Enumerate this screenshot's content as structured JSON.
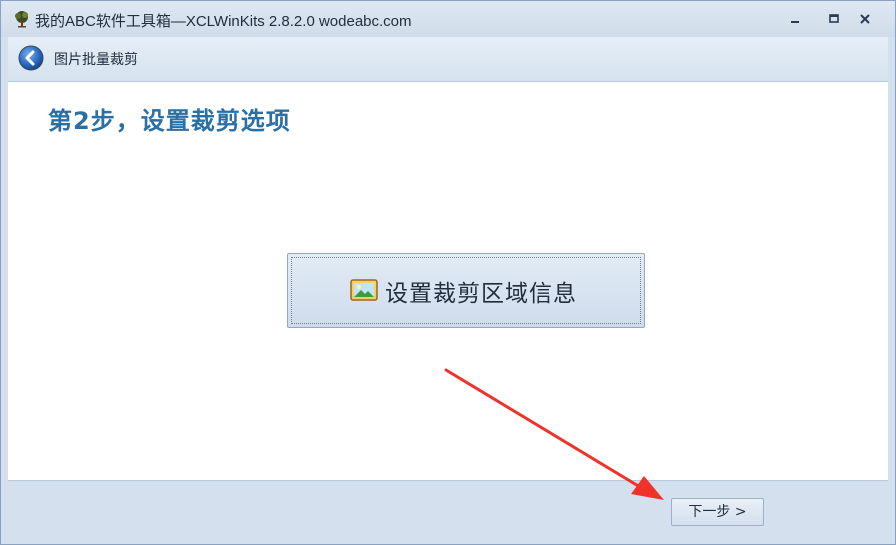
{
  "window": {
    "title": "我的ABC软件工具箱—XCLWinKits 2.8.2.0  wodeabc.com",
    "app_icon": "tree-logo-icon"
  },
  "nav": {
    "back_icon": "back-arrow-icon",
    "title": "图片批量裁剪"
  },
  "content": {
    "step_prefix": "第",
    "step_number": "2",
    "step_suffix": "步，设置裁剪选项",
    "crop_button": {
      "icon": "picture-icon",
      "label": "设置裁剪区域信息"
    }
  },
  "footer": {
    "next_label": "下一步 >"
  },
  "colors": {
    "accent_title": "#2a6fa5",
    "annotation_arrow": "#f0322b",
    "chrome_background": "#d4e0ee"
  }
}
